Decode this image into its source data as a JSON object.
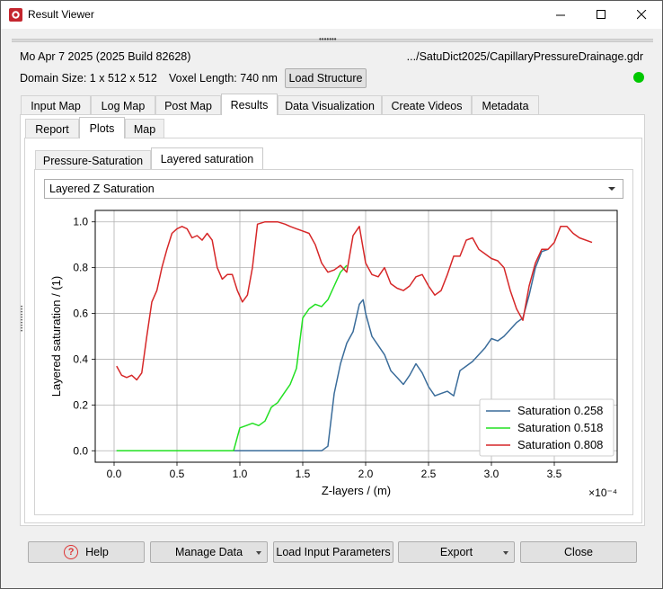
{
  "window": {
    "title": "Result Viewer"
  },
  "info": {
    "build": "Mo Apr 7 2025 (2025 Build 82628)",
    "path": ".../SatuDict2025/CapillaryPressureDrainage.gdr",
    "domain_size": "Domain Size: 1 x 512 x 512",
    "voxel_length": "Voxel Length: 740 nm",
    "load_structure": "Load Structure",
    "status_color": "#00c800"
  },
  "main_tabs": [
    "Input Map",
    "Log Map",
    "Post Map",
    "Results",
    "Data Visualization",
    "Create Videos",
    "Metadata"
  ],
  "main_tab_active": "Results",
  "sub_tabs": [
    "Report",
    "Plots",
    "Map"
  ],
  "sub_tab_active": "Plots",
  "plot_tabs": [
    "Pressure-Saturation",
    "Layered saturation"
  ],
  "plot_tab_active": "Layered saturation",
  "combo": {
    "selected": "Layered Z Saturation"
  },
  "footer": {
    "help": "Help",
    "manage_data": "Manage Data",
    "load_input": "Load Input Parameters",
    "export": "Export",
    "close": "Close"
  },
  "chart_data": {
    "type": "line",
    "xlabel": "Z-layers / (m)",
    "ylabel": "Layered saturation / (1)",
    "x_multiplier": "×10⁻⁴",
    "xlim": [
      -0.15,
      4.0
    ],
    "ylim": [
      -0.05,
      1.05
    ],
    "xticks": [
      "0.0",
      "0.5",
      "1.0",
      "1.5",
      "2.0",
      "2.5",
      "3.0",
      "3.5"
    ],
    "xtick_values": [
      0.0,
      0.5,
      1.0,
      1.5,
      2.0,
      2.5,
      3.0,
      3.5
    ],
    "yticks": [
      "0.0",
      "0.2",
      "0.4",
      "0.6",
      "0.8",
      "1.0"
    ],
    "ytick_values": [
      0.0,
      0.2,
      0.4,
      0.6,
      0.8,
      1.0
    ],
    "grid": true,
    "legend_position": "bottom-right",
    "series": [
      {
        "name": "Saturation 0.258",
        "color": "#3a6c9a",
        "x": [
          0.02,
          0.5,
          1.0,
          1.5,
          1.65,
          1.7,
          1.75,
          1.8,
          1.85,
          1.9,
          1.95,
          1.98,
          2.0,
          2.05,
          2.1,
          2.15,
          2.2,
          2.25,
          2.3,
          2.35,
          2.4,
          2.45,
          2.5,
          2.55,
          2.6,
          2.65,
          2.7,
          2.75,
          2.8,
          2.85,
          2.9,
          2.95,
          3.0,
          3.05,
          3.1,
          3.15,
          3.2,
          3.25,
          3.3,
          3.35,
          3.4,
          3.45
        ],
        "y": [
          0.0,
          0.0,
          0.0,
          0.0,
          0.0,
          0.02,
          0.25,
          0.38,
          0.47,
          0.52,
          0.64,
          0.66,
          0.6,
          0.5,
          0.46,
          0.42,
          0.35,
          0.32,
          0.29,
          0.33,
          0.38,
          0.34,
          0.28,
          0.24,
          0.25,
          0.26,
          0.24,
          0.35,
          0.37,
          0.39,
          0.42,
          0.45,
          0.49,
          0.48,
          0.5,
          0.53,
          0.56,
          0.58,
          0.68,
          0.8,
          0.87,
          0.88
        ]
      },
      {
        "name": "Saturation 0.518",
        "color": "#22e022",
        "x": [
          0.02,
          0.5,
          0.9,
          0.95,
          1.0,
          1.05,
          1.1,
          1.15,
          1.2,
          1.25,
          1.3,
          1.35,
          1.4,
          1.45,
          1.5,
          1.55,
          1.6,
          1.65,
          1.7,
          1.75,
          1.8,
          1.85
        ],
        "y": [
          0.0,
          0.0,
          0.0,
          0.0,
          0.1,
          0.11,
          0.12,
          0.11,
          0.13,
          0.19,
          0.21,
          0.25,
          0.29,
          0.36,
          0.58,
          0.62,
          0.64,
          0.63,
          0.66,
          0.72,
          0.78,
          0.81
        ]
      },
      {
        "name": "Saturation 0.808",
        "color": "#d62728",
        "x": [
          0.02,
          0.06,
          0.1,
          0.14,
          0.18,
          0.22,
          0.26,
          0.3,
          0.34,
          0.38,
          0.42,
          0.46,
          0.5,
          0.54,
          0.58,
          0.62,
          0.66,
          0.7,
          0.74,
          0.78,
          0.82,
          0.86,
          0.9,
          0.94,
          0.98,
          1.02,
          1.06,
          1.1,
          1.14,
          1.2,
          1.3,
          1.36,
          1.4,
          1.45,
          1.5,
          1.55,
          1.6,
          1.65,
          1.7,
          1.75,
          1.8,
          1.85,
          1.9,
          1.95,
          2.0,
          2.05,
          2.1,
          2.15,
          2.2,
          2.25,
          2.3,
          2.35,
          2.4,
          2.45,
          2.5,
          2.55,
          2.6,
          2.65,
          2.7,
          2.75,
          2.8,
          2.85,
          2.9,
          2.95,
          3.0,
          3.05,
          3.1,
          3.15,
          3.2,
          3.25,
          3.3,
          3.35,
          3.4,
          3.45,
          3.5,
          3.55,
          3.6,
          3.65,
          3.7,
          3.8
        ],
        "y": [
          0.37,
          0.33,
          0.32,
          0.33,
          0.31,
          0.34,
          0.5,
          0.65,
          0.7,
          0.8,
          0.88,
          0.95,
          0.97,
          0.98,
          0.97,
          0.93,
          0.94,
          0.92,
          0.95,
          0.92,
          0.8,
          0.75,
          0.77,
          0.77,
          0.7,
          0.65,
          0.68,
          0.8,
          0.99,
          1.0,
          1.0,
          0.99,
          0.98,
          0.97,
          0.96,
          0.95,
          0.9,
          0.82,
          0.78,
          0.79,
          0.81,
          0.78,
          0.94,
          0.98,
          0.82,
          0.77,
          0.76,
          0.8,
          0.73,
          0.71,
          0.7,
          0.72,
          0.76,
          0.77,
          0.72,
          0.68,
          0.7,
          0.77,
          0.85,
          0.85,
          0.92,
          0.93,
          0.88,
          0.86,
          0.84,
          0.83,
          0.8,
          0.7,
          0.62,
          0.57,
          0.72,
          0.82,
          0.88,
          0.88,
          0.91,
          0.98,
          0.98,
          0.95,
          0.93,
          0.91
        ]
      }
    ]
  }
}
